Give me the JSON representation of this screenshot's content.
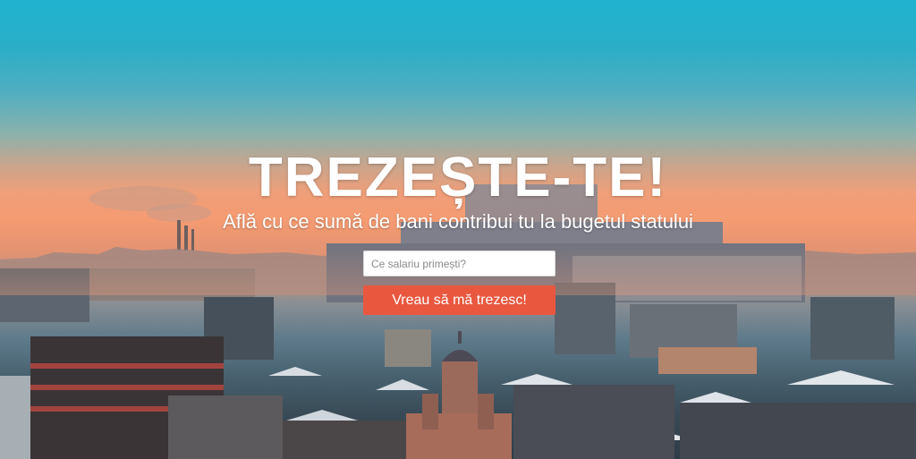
{
  "hero": {
    "title": "TREZEȘTE-TE!",
    "subtitle": "Află cu ce sumă de bani contribui tu la bugetul statului"
  },
  "form": {
    "salary_placeholder": "Ce salariu primești?",
    "salary_value": "",
    "submit_label": "Vreau să mă trezesc!"
  },
  "colors": {
    "accent_button": "#e9573f",
    "sky_top": "#1fb3cf",
    "sky_horizon": "#f59b72"
  }
}
